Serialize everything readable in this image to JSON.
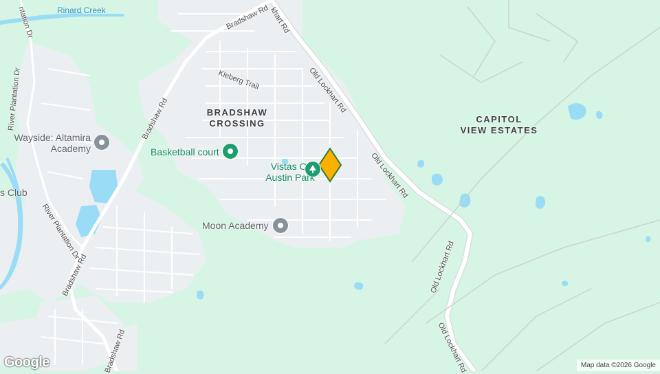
{
  "map": {
    "colors": {
      "land": "#d6f5e4",
      "urban": "#eceff2",
      "road": "#ffffff",
      "water": "#9adcf5",
      "park_icon": "#1e9e6e",
      "school_icon": "#8a9299",
      "marker": "#fbb000"
    },
    "water_labels": [
      "Rinard Creek"
    ],
    "area_labels": {
      "bradshaw_crossing_line1": "BRADSHAW",
      "bradshaw_crossing_line2": "CROSSING",
      "capitol_view_line1": "CAPITOL",
      "capitol_view_line2": "VIEW ESTATES"
    },
    "road_labels": {
      "bradshaw_rd_top": "Bradshaw Rd",
      "old_lockhart_top": "Old Lockhart Rd",
      "old_lockhart_mid": "Old Lockhart Rd",
      "old_lockhart_right": "Old Lockhart Rd",
      "old_lockhart_lower": "Old Lockhart Rd",
      "old_lockhart_bottom": "Old Lockhart Rd",
      "old_lockhart_cut": "khart Rd",
      "kleberg_trail": "Kleberg Trail",
      "bradshaw_rd_left": "Bradshaw Rd",
      "bradshaw_rd_lower": "Bradshaw Rd",
      "bradshaw_rd_bottom": "Bradshaw Rd",
      "river_plantation_top": "River Plantation Dr",
      "river_plantation_mid": "River Plantation Dr",
      "river_plantation_cut": "ntation Dr"
    },
    "pois": [
      {
        "line1": "Wayside: Altamira",
        "line2": "Academy",
        "icon": "school-icon"
      },
      {
        "line1": "Basketball court",
        "line2": "",
        "icon": "park-icon"
      },
      {
        "line1": "Vistas Of",
        "line2": "Austin Park",
        "icon": "tree-icon"
      },
      {
        "line1": "Moon Academy",
        "line2": "",
        "icon": "school-icon"
      },
      {
        "line1": "s Club",
        "line2": "",
        "icon": ""
      }
    ],
    "marker_icon": "location-marker-icon",
    "logo": "Google",
    "attribution": "Map data ©2026 Google"
  }
}
